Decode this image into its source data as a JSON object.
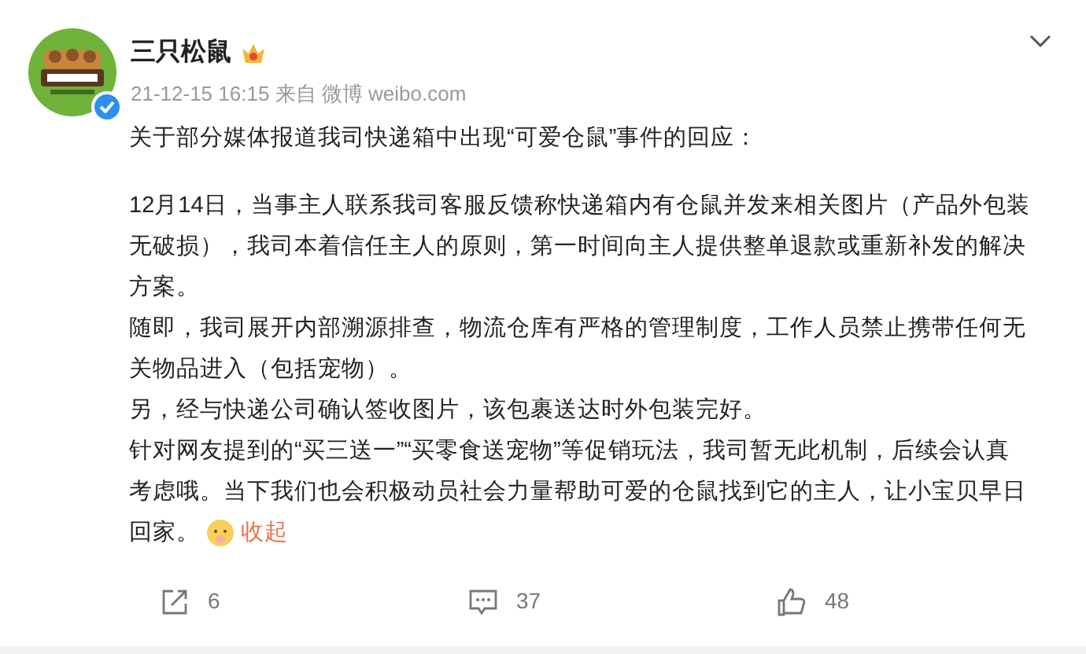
{
  "account": {
    "name": "三只松鼠",
    "verified": true
  },
  "post": {
    "time": "21-12-15 16:15",
    "source": "来自 微博 weibo.com",
    "paragraphs": [
      {
        "lines": [
          "关于部分媒体报道我司快递箱中出现“可爱仓鼠”事件的回应："
        ]
      },
      {
        "lines": [
          "12月14日，当事主人联系我司客服反馈称快递箱内有仓鼠并发来相关图片（产品外包装",
          "无破损），我司本着信任主人的原则，第一时间向主人提供整单退款或重新补发的解决",
          "方案。"
        ]
      },
      {
        "lines": [
          "随即，我司展开内部溯源排查，物流仓库有严格的管理制度，工作人员禁止携带任何无",
          "关物品进入（包括宠物）。"
        ]
      },
      {
        "lines": [
          "另，经与快递公司确认签收图片，该包裹送达时外包装完好。"
        ]
      },
      {
        "lines": [
          "针对网友提到的“买三送一”“买零食送宠物”等促销玩法，我司暂无此机制，后续会认真",
          "考虑哦。当下我们也会积极动员社会力量帮助可爱的仓鼠找到它的主人，让小宝贝早日",
          "回家。"
        ]
      }
    ],
    "collapse_link": "收起"
  },
  "actions": [
    {
      "kind": "repost",
      "count": "6"
    },
    {
      "kind": "comment",
      "count": "37"
    },
    {
      "kind": "like",
      "count": "48"
    }
  ]
}
